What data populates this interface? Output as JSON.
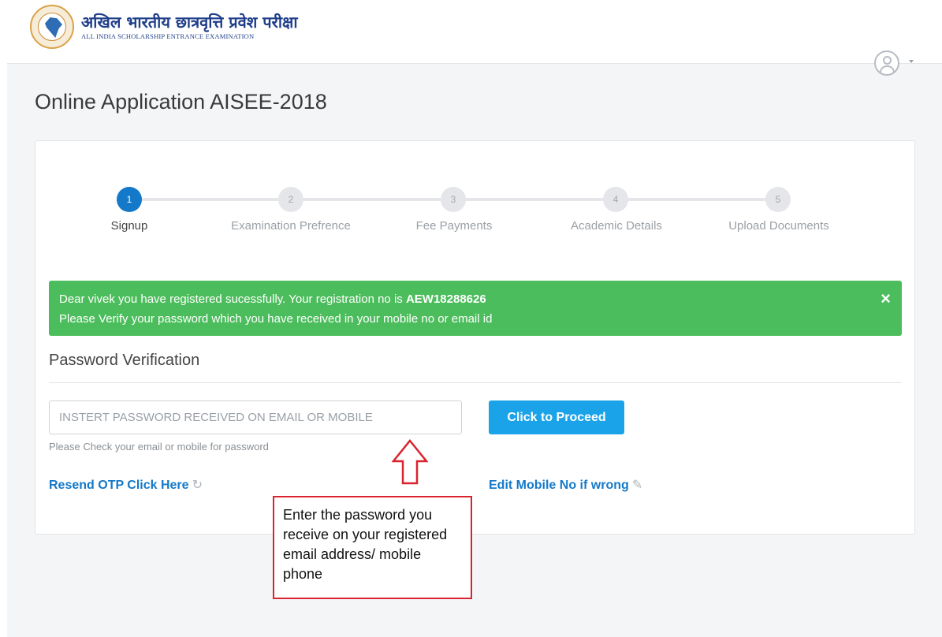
{
  "header": {
    "logo_hindi": "अखिल भारतीय छात्रवृत्ति प्रवेश परीक्षा",
    "logo_english": "ALL INDIA SCHOLARSHIP ENTRANCE EXAMINATION",
    "user_icon": "user-circle-icon",
    "caret_icon": "chevron-down-icon"
  },
  "page": {
    "title": "Online Application AISEE-2018"
  },
  "stepper": {
    "steps": [
      {
        "number": "1",
        "label": "Signup",
        "active": true
      },
      {
        "number": "2",
        "label": "Examination Prefrence",
        "active": false
      },
      {
        "number": "3",
        "label": "Fee Payments",
        "active": false
      },
      {
        "number": "4",
        "label": "Academic Details",
        "active": false
      },
      {
        "number": "5",
        "label": "Upload Documents",
        "active": false
      }
    ],
    "active_color": "#1479c9"
  },
  "alert": {
    "line1_prefix": "Dear vivek you have registered sucessfully. Your registration no is ",
    "registration_no": "AEW18288626",
    "line2": "Please Verify your password which you have received in your mobile no or email id",
    "close_label": "×",
    "color": "#4cbd5c"
  },
  "verification": {
    "title": "Password Verification",
    "input_placeholder": "INSTERT PASSWORD RECEIVED ON EMAIL OR MOBILE",
    "input_value": "",
    "help_text": "Please Check your email or mobile for password",
    "proceed_label": "Click to Proceed",
    "resend_label": "Resend OTP Click Here",
    "resend_icon": "refresh-icon",
    "edit_label": "Edit Mobile No if wrong",
    "edit_icon": "pencil-icon",
    "button_color": "#1aa3e8"
  },
  "annotation": {
    "callout_text": "Enter the password you receive on your registered email address/ mobile phone",
    "arrow_icon": "up-arrow-icon",
    "border_color": "#d9232e"
  }
}
